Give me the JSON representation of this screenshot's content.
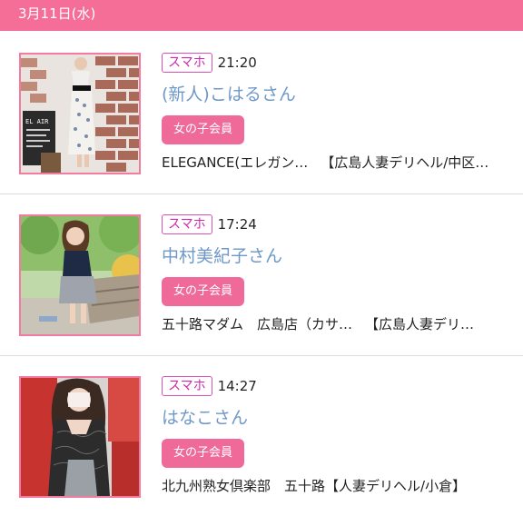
{
  "date_header": "3月11日(水)",
  "entries": [
    {
      "badge": "スマホ",
      "time": "21:20",
      "name": "(新人)こはるさん",
      "member_label": "女の子会員",
      "shop": "ELEGANCE(エレガン…",
      "area": "【広島人妻デリヘル/中区…",
      "thumb_text": "EL AIR"
    },
    {
      "badge": "スマホ",
      "time": "17:24",
      "name": "中村美紀子さん",
      "member_label": "女の子会員",
      "shop": "五十路マダム　広島店（カサ…",
      "area": "【広島人妻デリ…"
    },
    {
      "badge": "スマホ",
      "time": "14:27",
      "name": "はなこさん",
      "member_label": "女の子会員",
      "shop": "北九州熟女倶楽部　五十路",
      "area": "【人妻デリヘル/小倉】"
    }
  ],
  "colors": {
    "header": "#f46e97",
    "accent_pink": "#ef6a98",
    "badge_magenta": "#d028ad",
    "name_blue": "#6f98c8"
  }
}
